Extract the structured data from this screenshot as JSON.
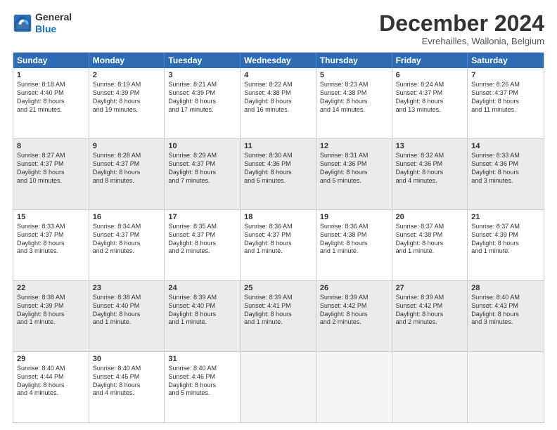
{
  "logo": {
    "general": "General",
    "blue": "Blue"
  },
  "title": "December 2024",
  "subtitle": "Evrehailles, Wallonia, Belgium",
  "headers": [
    "Sunday",
    "Monday",
    "Tuesday",
    "Wednesday",
    "Thursday",
    "Friday",
    "Saturday"
  ],
  "rows": [
    [
      {
        "day": "1",
        "lines": [
          "Sunrise: 8:18 AM",
          "Sunset: 4:40 PM",
          "Daylight: 8 hours",
          "and 21 minutes."
        ]
      },
      {
        "day": "2",
        "lines": [
          "Sunrise: 8:19 AM",
          "Sunset: 4:39 PM",
          "Daylight: 8 hours",
          "and 19 minutes."
        ]
      },
      {
        "day": "3",
        "lines": [
          "Sunrise: 8:21 AM",
          "Sunset: 4:39 PM",
          "Daylight: 8 hours",
          "and 17 minutes."
        ]
      },
      {
        "day": "4",
        "lines": [
          "Sunrise: 8:22 AM",
          "Sunset: 4:38 PM",
          "Daylight: 8 hours",
          "and 16 minutes."
        ]
      },
      {
        "day": "5",
        "lines": [
          "Sunrise: 8:23 AM",
          "Sunset: 4:38 PM",
          "Daylight: 8 hours",
          "and 14 minutes."
        ]
      },
      {
        "day": "6",
        "lines": [
          "Sunrise: 8:24 AM",
          "Sunset: 4:37 PM",
          "Daylight: 8 hours",
          "and 13 minutes."
        ]
      },
      {
        "day": "7",
        "lines": [
          "Sunrise: 8:26 AM",
          "Sunset: 4:37 PM",
          "Daylight: 8 hours",
          "and 11 minutes."
        ]
      }
    ],
    [
      {
        "day": "8",
        "lines": [
          "Sunrise: 8:27 AM",
          "Sunset: 4:37 PM",
          "Daylight: 8 hours",
          "and 10 minutes."
        ]
      },
      {
        "day": "9",
        "lines": [
          "Sunrise: 8:28 AM",
          "Sunset: 4:37 PM",
          "Daylight: 8 hours",
          "and 8 minutes."
        ]
      },
      {
        "day": "10",
        "lines": [
          "Sunrise: 8:29 AM",
          "Sunset: 4:37 PM",
          "Daylight: 8 hours",
          "and 7 minutes."
        ]
      },
      {
        "day": "11",
        "lines": [
          "Sunrise: 8:30 AM",
          "Sunset: 4:36 PM",
          "Daylight: 8 hours",
          "and 6 minutes."
        ]
      },
      {
        "day": "12",
        "lines": [
          "Sunrise: 8:31 AM",
          "Sunset: 4:36 PM",
          "Daylight: 8 hours",
          "and 5 minutes."
        ]
      },
      {
        "day": "13",
        "lines": [
          "Sunrise: 8:32 AM",
          "Sunset: 4:36 PM",
          "Daylight: 8 hours",
          "and 4 minutes."
        ]
      },
      {
        "day": "14",
        "lines": [
          "Sunrise: 8:33 AM",
          "Sunset: 4:36 PM",
          "Daylight: 8 hours",
          "and 3 minutes."
        ]
      }
    ],
    [
      {
        "day": "15",
        "lines": [
          "Sunrise: 8:33 AM",
          "Sunset: 4:37 PM",
          "Daylight: 8 hours",
          "and 3 minutes."
        ]
      },
      {
        "day": "16",
        "lines": [
          "Sunrise: 8:34 AM",
          "Sunset: 4:37 PM",
          "Daylight: 8 hours",
          "and 2 minutes."
        ]
      },
      {
        "day": "17",
        "lines": [
          "Sunrise: 8:35 AM",
          "Sunset: 4:37 PM",
          "Daylight: 8 hours",
          "and 2 minutes."
        ]
      },
      {
        "day": "18",
        "lines": [
          "Sunrise: 8:36 AM",
          "Sunset: 4:37 PM",
          "Daylight: 8 hours",
          "and 1 minute."
        ]
      },
      {
        "day": "19",
        "lines": [
          "Sunrise: 8:36 AM",
          "Sunset: 4:38 PM",
          "Daylight: 8 hours",
          "and 1 minute."
        ]
      },
      {
        "day": "20",
        "lines": [
          "Sunrise: 8:37 AM",
          "Sunset: 4:38 PM",
          "Daylight: 8 hours",
          "and 1 minute."
        ]
      },
      {
        "day": "21",
        "lines": [
          "Sunrise: 8:37 AM",
          "Sunset: 4:39 PM",
          "Daylight: 8 hours",
          "and 1 minute."
        ]
      }
    ],
    [
      {
        "day": "22",
        "lines": [
          "Sunrise: 8:38 AM",
          "Sunset: 4:39 PM",
          "Daylight: 8 hours",
          "and 1 minute."
        ]
      },
      {
        "day": "23",
        "lines": [
          "Sunrise: 8:38 AM",
          "Sunset: 4:40 PM",
          "Daylight: 8 hours",
          "and 1 minute."
        ]
      },
      {
        "day": "24",
        "lines": [
          "Sunrise: 8:39 AM",
          "Sunset: 4:40 PM",
          "Daylight: 8 hours",
          "and 1 minute."
        ]
      },
      {
        "day": "25",
        "lines": [
          "Sunrise: 8:39 AM",
          "Sunset: 4:41 PM",
          "Daylight: 8 hours",
          "and 1 minute."
        ]
      },
      {
        "day": "26",
        "lines": [
          "Sunrise: 8:39 AM",
          "Sunset: 4:42 PM",
          "Daylight: 8 hours",
          "and 2 minutes."
        ]
      },
      {
        "day": "27",
        "lines": [
          "Sunrise: 8:39 AM",
          "Sunset: 4:42 PM",
          "Daylight: 8 hours",
          "and 2 minutes."
        ]
      },
      {
        "day": "28",
        "lines": [
          "Sunrise: 8:40 AM",
          "Sunset: 4:43 PM",
          "Daylight: 8 hours",
          "and 3 minutes."
        ]
      }
    ],
    [
      {
        "day": "29",
        "lines": [
          "Sunrise: 8:40 AM",
          "Sunset: 4:44 PM",
          "Daylight: 8 hours",
          "and 4 minutes."
        ]
      },
      {
        "day": "30",
        "lines": [
          "Sunrise: 8:40 AM",
          "Sunset: 4:45 PM",
          "Daylight: 8 hours",
          "and 4 minutes."
        ]
      },
      {
        "day": "31",
        "lines": [
          "Sunrise: 8:40 AM",
          "Sunset: 4:46 PM",
          "Daylight: 8 hours",
          "and 5 minutes."
        ]
      },
      null,
      null,
      null,
      null
    ]
  ]
}
